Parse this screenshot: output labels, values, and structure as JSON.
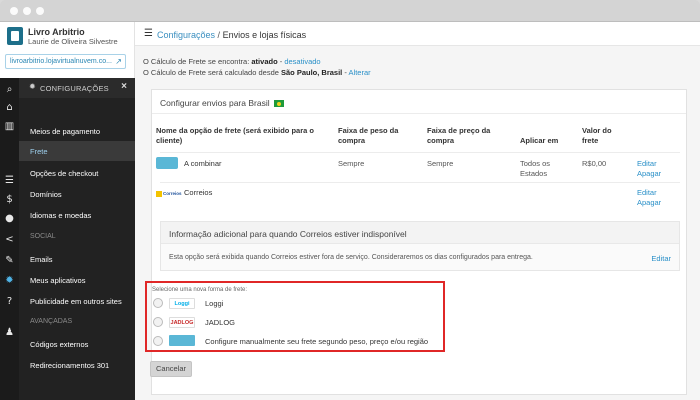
{
  "brand": {
    "title": "Livro Arbitrio",
    "subtitle": "Laurie de Oliveira Silvestre",
    "store_url": "livroarbitrio.lojavirtualnuvem.co..."
  },
  "sidebar": {
    "config_header": "CONFIGURAÇÕES",
    "items": [
      {
        "label": "Meios de pagamento",
        "active": false
      },
      {
        "label": "Frete",
        "active": true
      },
      {
        "label": "Opções de checkout",
        "active": false
      },
      {
        "label": "Domínios",
        "active": false
      },
      {
        "label": "Idiomas e moedas",
        "active": false
      }
    ],
    "section_social": "SOCIAL",
    "social_items": [
      {
        "label": "Emails"
      },
      {
        "label": "Meus aplicativos"
      },
      {
        "label": "Publicidade em outros sites"
      }
    ],
    "section_advanced": "AVANÇADAS",
    "advanced_items": [
      {
        "label": "Códigos externos"
      },
      {
        "label": "Redirecionamentos 301"
      }
    ],
    "rail_icons": [
      "search-icon",
      "home-icon",
      "chart-icon",
      "list-icon",
      "dollar-icon",
      "user-icon",
      "share-icon",
      "brush-icon",
      "gear-icon",
      "help-icon",
      "person-icon"
    ]
  },
  "header": {
    "breadcrumb_parent": "Configurações",
    "separator": " / ",
    "breadcrumb_current": "Envios e lojas físicas"
  },
  "status": {
    "line1_prefix": "O Cálculo de Frete se encontra: ",
    "line1_value": "ativado",
    "line1_link": "desativado",
    "line2_prefix": "O Cálculo de Frete será calculado desde ",
    "line2_value": "São Paulo, Brasil",
    "line2_link": "Alterar"
  },
  "shipping": {
    "card_title": "Configurar envios para Brasil",
    "columns": [
      "Nome da opção de frete (será exibido para o cliente)",
      "Faixa de peso da compra",
      "Faixa de preço da compra",
      "Aplicar em",
      "Valor do frete"
    ],
    "rows": [
      {
        "name": "A combinar",
        "weight": "Sempre",
        "price": "Sempre",
        "apply": "Todos os Estados",
        "value": "R$0,00",
        "edit": "Editar",
        "delete": "Apagar"
      },
      {
        "name": "Correios",
        "logo_text": "Correios",
        "weight": "",
        "price": "",
        "apply": "",
        "value": "",
        "edit": "Editar",
        "delete": "Apagar"
      }
    ],
    "info_title": "Informação adicional para quando Correios estiver indisponível",
    "info_text": "Esta opção será exibida quando Correios estiver fora de serviço. Consideraremos os dias configurados para entrega.",
    "info_edit": "Editar"
  },
  "new_option": {
    "caption": "Selecione uma nova forma de frete:",
    "options": [
      {
        "logo": "Loggi",
        "label": "Loggi"
      },
      {
        "logo": "JADLOG",
        "label": "JADLOG"
      },
      {
        "logo": "",
        "label": "Configure manualmente seu frete segundo peso, preço e/ou região"
      }
    ]
  },
  "actions": {
    "cancel": "Cancelar"
  },
  "colors": {
    "accent": "#2a90c8",
    "sidebar": "#222222",
    "highlight": "#e02727"
  }
}
